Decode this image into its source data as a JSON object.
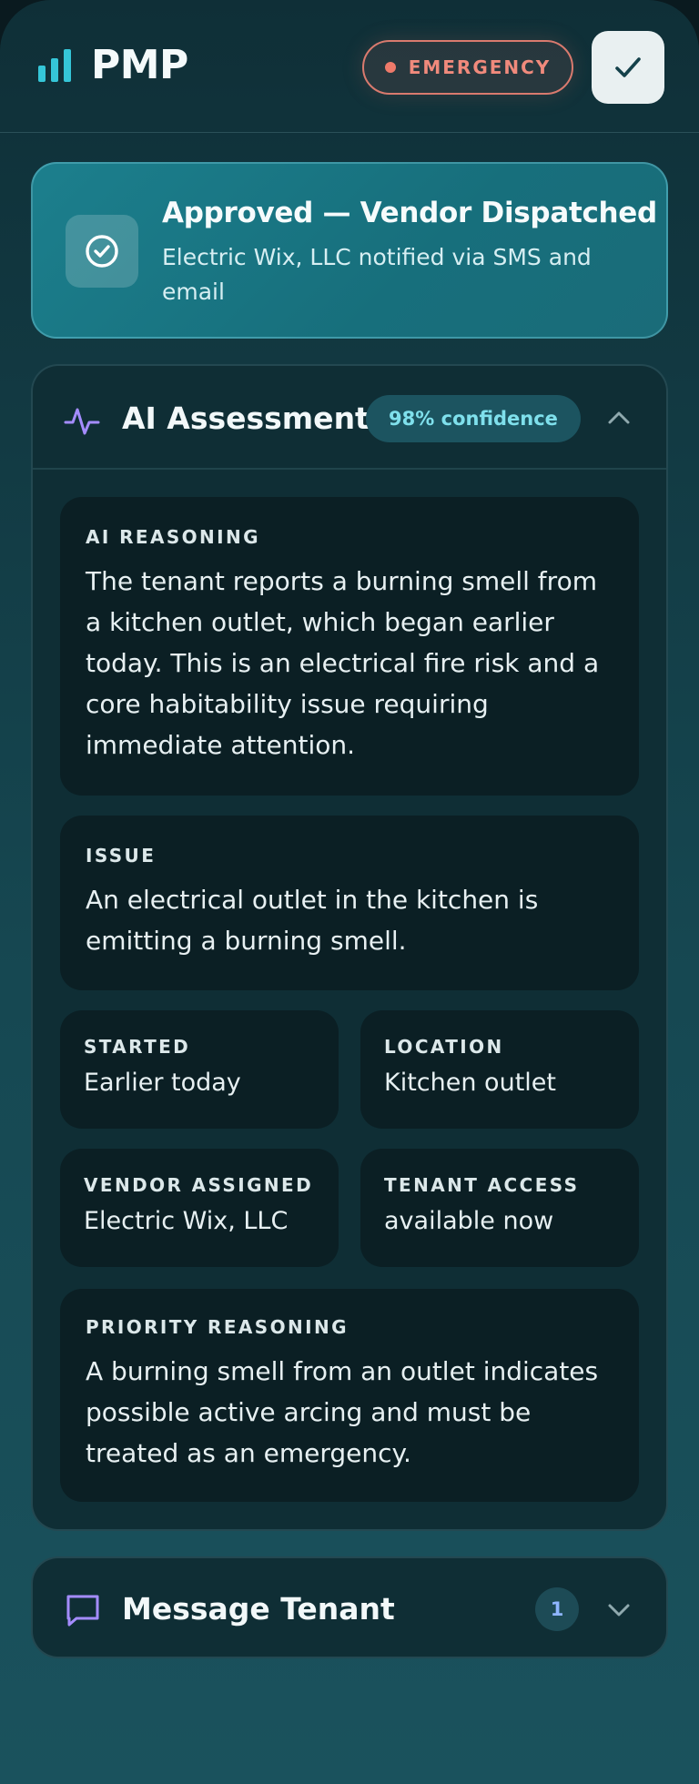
{
  "app": {
    "name": "PMP"
  },
  "header": {
    "emergency_label": "EMERGENCY",
    "confirm_icon": "checkmark-icon"
  },
  "colors": {
    "accent": "#1c7f8d",
    "emergency": "#f08a7c",
    "confidence": "#7fe0ec",
    "message_icon": "#a48cff"
  },
  "approved": {
    "title": "Approved — Vendor Dispatched",
    "subtitle": "Electric Wix, LLC notified via SMS and email"
  },
  "assessment": {
    "title": "AI Assessment",
    "confidence": "98% confidence",
    "reasoning": {
      "label": "AI REASONING",
      "text": "The tenant reports a burning smell from a kitchen outlet, which began earlier today. This is an electrical fire risk and a core habitability issue requiring immediate attention."
    },
    "issue": {
      "label": "ISSUE",
      "text": "An electrical outlet in the kitchen is emitting a burning smell."
    },
    "started": {
      "label": "STARTED",
      "value": "Earlier today"
    },
    "location": {
      "label": "LOCATION",
      "value": "Kitchen outlet"
    },
    "vendor": {
      "label": "VENDOR ASSIGNED",
      "value": "Electric Wix, LLC"
    },
    "access": {
      "label": "TENANT ACCESS",
      "value": "available now"
    },
    "priority": {
      "label": "PRIORITY REASONING",
      "text": "A burning smell from an outlet indicates possible active arcing and must be treated as an emergency."
    }
  },
  "message": {
    "title": "Message Tenant",
    "count": "1"
  }
}
